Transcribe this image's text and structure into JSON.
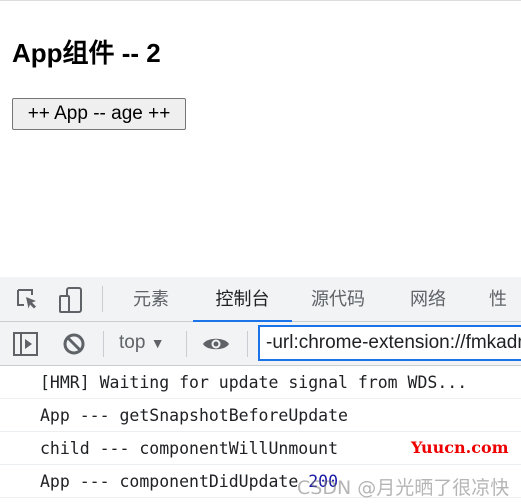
{
  "page": {
    "title": "App组件 -- 2",
    "button_label": "++ App -- age ++"
  },
  "devtools": {
    "tabs": [
      {
        "label": "元素"
      },
      {
        "label": "控制台",
        "active": true
      },
      {
        "label": "源代码"
      },
      {
        "label": "网络"
      },
      {
        "label": "性能"
      }
    ],
    "context": "top",
    "filter_value": "-url:chrome-extension://fmkadmapgofadopljbjfkapdkoienihi",
    "logs": [
      {
        "text": "[HMR] Waiting for update signal from WDS..."
      },
      {
        "text": "App --- getSnapshotBeforeUpdate"
      },
      {
        "text": "child --- componentWillUnmount"
      },
      {
        "text": "App --- componentDidUpdate ",
        "number": "200"
      }
    ]
  },
  "watermarks": {
    "site": "Yuucn.com",
    "csdn": "CSDN @月光晒了很凉快"
  },
  "colors": {
    "accent": "#1a73e8",
    "number": "#1a1aa6"
  }
}
